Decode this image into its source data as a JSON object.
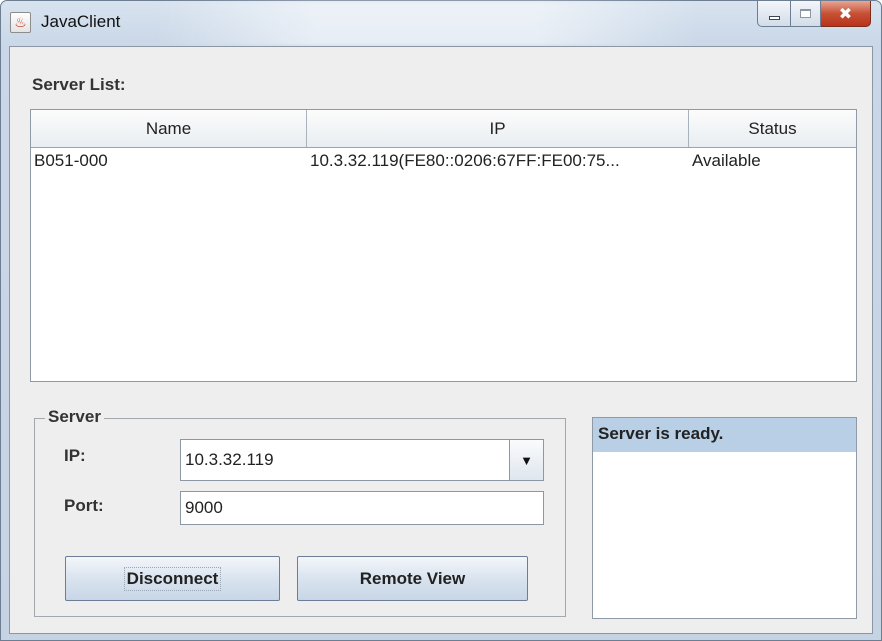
{
  "window": {
    "title": "JavaClient",
    "app_icon": "java-cup-icon",
    "app_icon_glyph": "♨",
    "minimize_icon": "minimize-icon",
    "maximize_icon": "maximize-icon",
    "close_icon": "close-icon",
    "close_glyph": "✖",
    "close_color": "#c75134"
  },
  "server_list": {
    "label": "Server List:",
    "columns": [
      "Name",
      "IP",
      "Status"
    ],
    "rows": [
      [
        "B051-000",
        "10.3.32.119(FE80::0206:67FF:FE00:75...",
        "Available"
      ]
    ]
  },
  "server_group": {
    "title": "Server",
    "ip_label": "IP:",
    "ip_value": "10.3.32.119",
    "dropdown_icon": "caret-down-icon",
    "dropdown_glyph": "▼",
    "port_label": "Port:",
    "port_value": "9000",
    "disconnect_label": "Disconnect",
    "remote_view_label": "Remote View"
  },
  "status": {
    "message": "Server is ready.",
    "highlight_color": "#b8cfe6"
  }
}
